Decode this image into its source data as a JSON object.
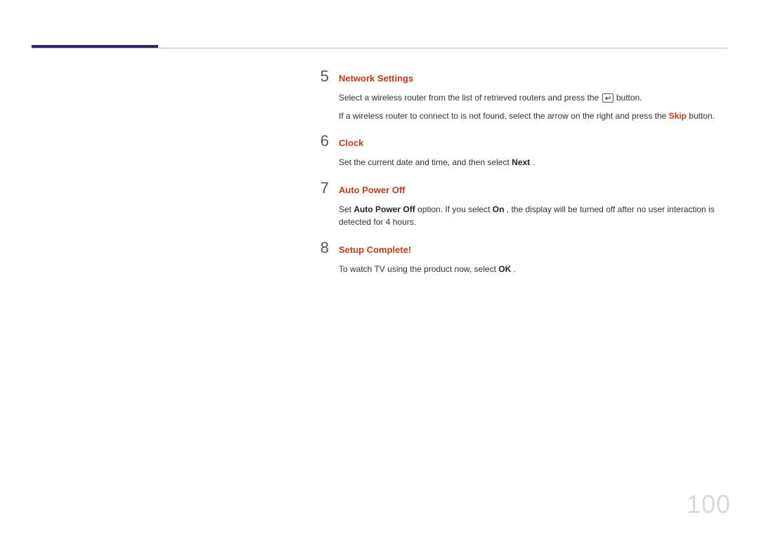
{
  "steps": [
    {
      "num": "5",
      "title": "Network Settings",
      "body": {
        "line1_a": "Select a wireless router from the list of retrieved routers and press the ",
        "line1_b": " button.",
        "line2_a": "If a wireless router to connect to is not found, select the arrow on the right and press the ",
        "skip_label": "Skip",
        "line2_b": " button."
      }
    },
    {
      "num": "6",
      "title": "Clock",
      "body": {
        "line1_a": "Set the current date and time, and then select ",
        "next_label": "Next",
        "line1_b": "."
      }
    },
    {
      "num": "7",
      "title": "Auto Power Off",
      "body": {
        "line1_a": "Set ",
        "apo_label": "Auto Power Off",
        "line1_b": " option. If you select ",
        "on_label": "On",
        "line1_c": ", the display will be turned off after no user interaction is detected for 4 hours."
      }
    },
    {
      "num": "8",
      "title": "Setup Complete!",
      "body": {
        "line1_a": "To watch TV using the product now, select ",
        "ok_label": "OK",
        "line1_b": "."
      }
    }
  ],
  "page_number": "100"
}
